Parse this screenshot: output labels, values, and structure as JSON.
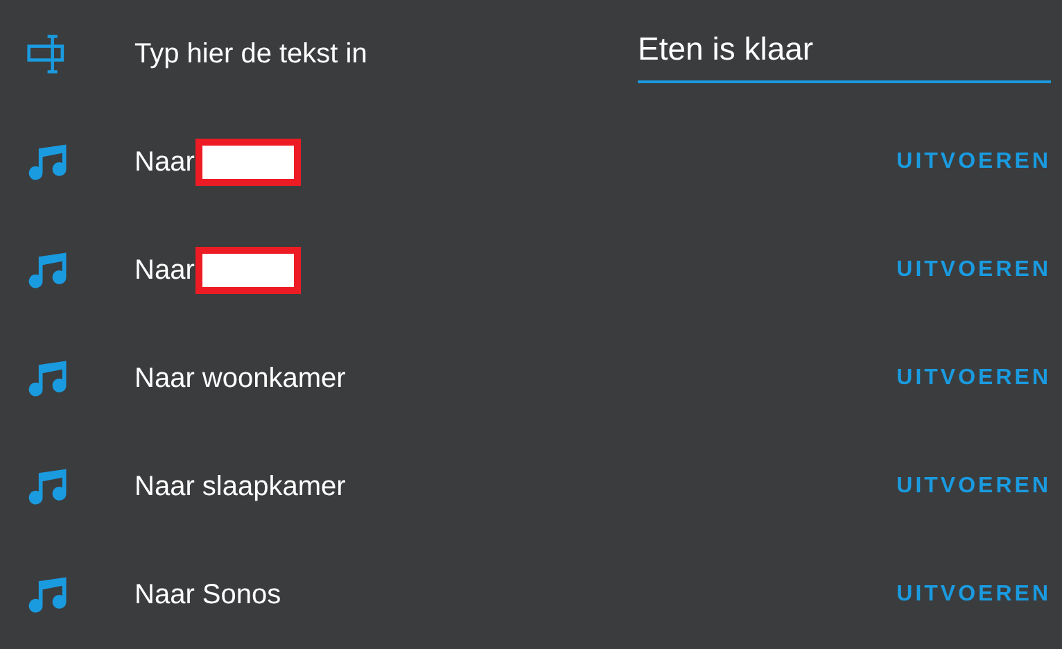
{
  "rows": [
    {
      "kind": "text",
      "label": "Typ hier de tekst in",
      "value": "Eten is klaar"
    },
    {
      "kind": "script",
      "label": "Naar",
      "redacted": true,
      "action": "UITVOEREN"
    },
    {
      "kind": "script",
      "label": "Naar",
      "redacted": true,
      "action": "UITVOEREN"
    },
    {
      "kind": "script",
      "label": "Naar woonkamer",
      "redacted": false,
      "action": "UITVOEREN"
    },
    {
      "kind": "script",
      "label": "Naar slaapkamer",
      "redacted": false,
      "action": "UITVOEREN"
    },
    {
      "kind": "script",
      "label": "Naar Sonos",
      "redacted": false,
      "action": "UITVOEREN"
    }
  ]
}
